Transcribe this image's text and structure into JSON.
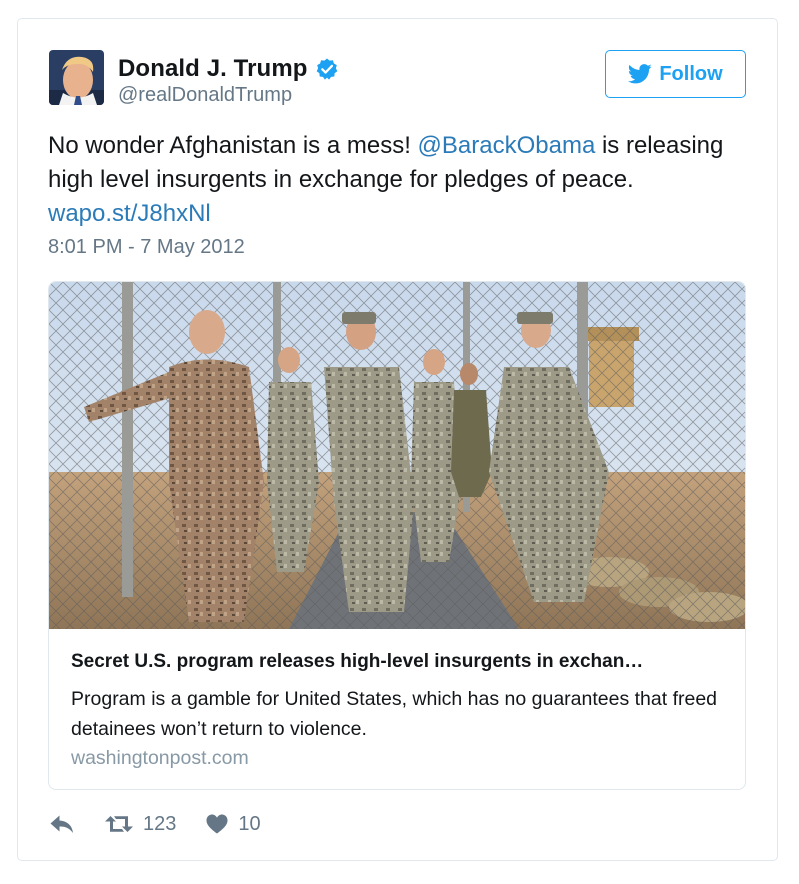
{
  "tweet": {
    "author": {
      "name": "Donald J. Trump",
      "handle": "@realDonaldTrump",
      "verified_icon": "verified-badge-icon",
      "avatar": "profile-photo"
    },
    "follow_label": "Follow",
    "text": {
      "part1": "No wonder Afghanistan is a mess! ",
      "mention": "@BarackObama",
      "part2": " is releasing high level insurgents in exchange for pledges of peace.",
      "link": "wapo.st/J8hxNl"
    },
    "timestamp": "8:01 PM - 7 May 2012",
    "card": {
      "image": "soldiers-walking-through-fenced-detention-facility-photo",
      "title": "Secret U.S. program releases high-level insurgents in exchan…",
      "description": "Program is a gamble for United States, which has no guarantees that freed detainees won’t return to violence.",
      "domain": "washingtonpost.com"
    },
    "actions": {
      "reply_icon": "reply-icon",
      "retweet_icon": "retweet-icon",
      "retweet_count": "123",
      "like_icon": "heart-icon",
      "like_count": "10"
    }
  },
  "colors": {
    "link": "#2b7bb9",
    "twitter_blue": "#1da1f2",
    "secondary_text": "#657786",
    "border": "#e1e8ed"
  }
}
